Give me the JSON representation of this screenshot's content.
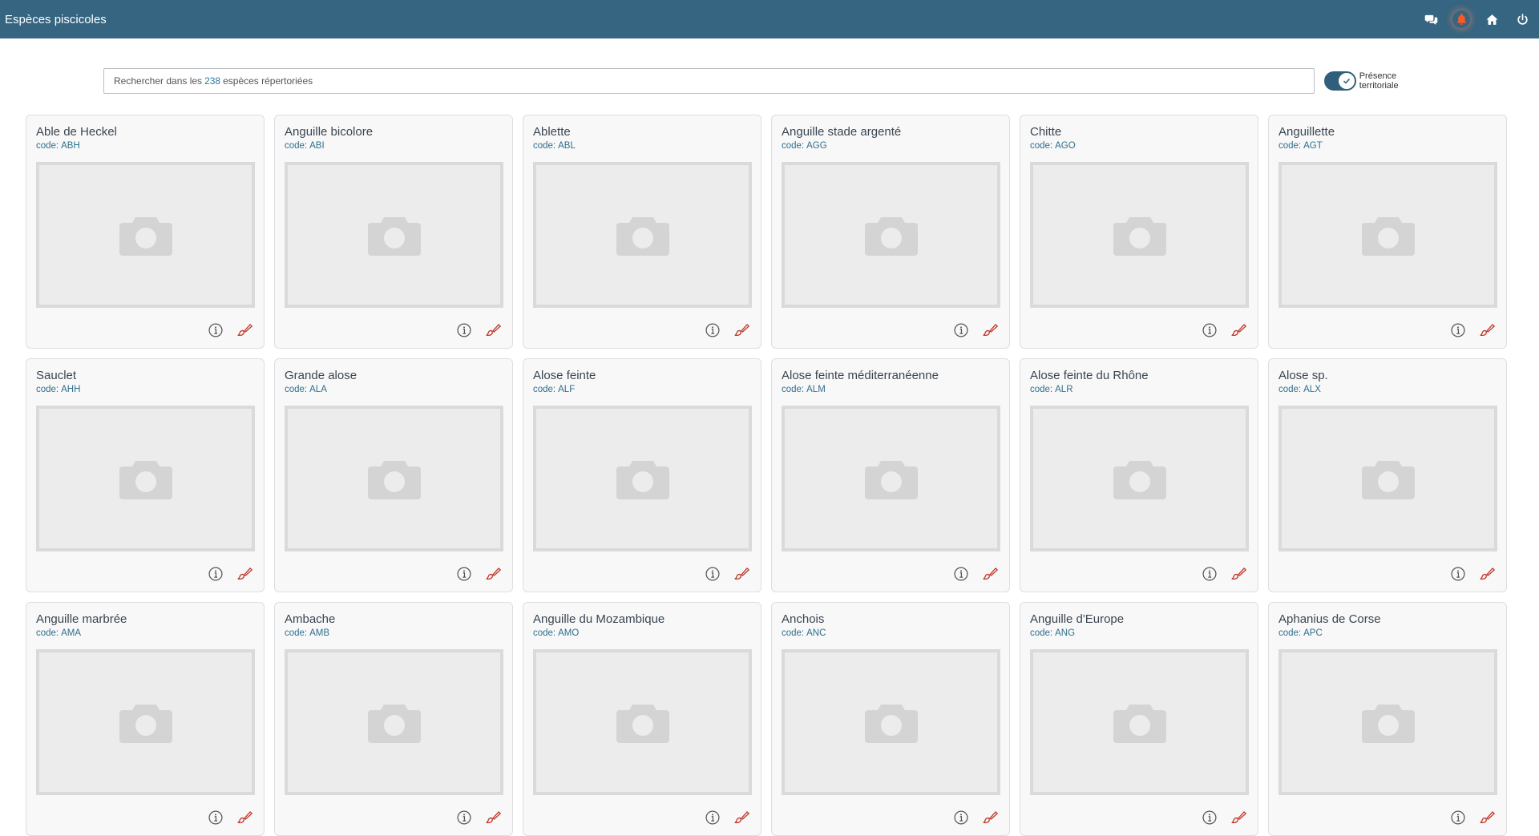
{
  "header": {
    "title": "Espèces piscicoles",
    "icons": [
      "chat-icon",
      "bell-icon",
      "home-icon",
      "power-icon"
    ],
    "bell_color": "#ff5722",
    "bar_color": "#356581"
  },
  "search": {
    "prefix": "Rechercher dans les",
    "count": "238",
    "suffix": "espèces répertoriées"
  },
  "toggle": {
    "label": "Présence territoriale",
    "checked": true
  },
  "code_prefix": "code:",
  "species": [
    {
      "name": "Able de Heckel",
      "code": "ABH"
    },
    {
      "name": "Anguille bicolore",
      "code": "ABI"
    },
    {
      "name": "Ablette",
      "code": "ABL"
    },
    {
      "name": "Anguille stade argenté",
      "code": "AGG"
    },
    {
      "name": "Chitte",
      "code": "AGO"
    },
    {
      "name": "Anguillette",
      "code": "AGT"
    },
    {
      "name": "Sauclet",
      "code": "AHH"
    },
    {
      "name": "Grande alose",
      "code": "ALA"
    },
    {
      "name": "Alose feinte",
      "code": "ALF"
    },
    {
      "name": "Alose feinte méditerranéenne",
      "code": "ALM"
    },
    {
      "name": "Alose feinte du Rhône",
      "code": "ALR"
    },
    {
      "name": "Alose sp.",
      "code": "ALX"
    },
    {
      "name": "Anguille marbrée",
      "code": "AMA"
    },
    {
      "name": "Ambache",
      "code": "AMB"
    },
    {
      "name": "Anguille du Mozambique",
      "code": "AMO"
    },
    {
      "name": "Anchois",
      "code": "ANC"
    },
    {
      "name": "Anguille d'Europe",
      "code": "ANG"
    },
    {
      "name": "Aphanius de Corse",
      "code": "APC"
    }
  ],
  "card_icons": [
    "camera-placeholder-icon",
    "info-icon",
    "brush-icon"
  ],
  "brush_color": "#c0392b"
}
